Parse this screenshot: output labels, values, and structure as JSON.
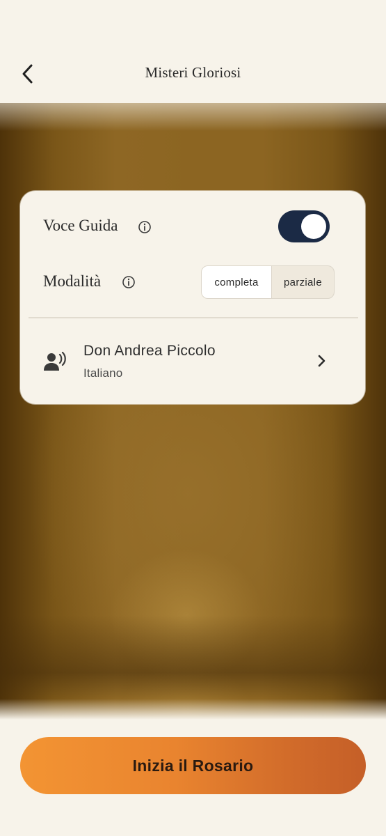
{
  "header": {
    "title": "Misteri Gloriosi",
    "back_icon": "chevron-left-icon"
  },
  "settings": {
    "voice_guide": {
      "label": "Voce Guida",
      "info_icon": "info-icon",
      "enabled": true,
      "toggle_color": "#1b2a45"
    },
    "mode": {
      "label": "Modalità",
      "info_icon": "info-icon",
      "options": [
        "completa",
        "parziale"
      ],
      "selected": "completa"
    },
    "guide": {
      "icon": "speaking-person-icon",
      "name": "Don Andrea Piccolo",
      "language": "Italiano",
      "chevron_icon": "chevron-right-icon"
    }
  },
  "footer": {
    "start_label": "Inizia il Rosario",
    "start_gradient": [
      "#f39433",
      "#c55f28"
    ]
  }
}
